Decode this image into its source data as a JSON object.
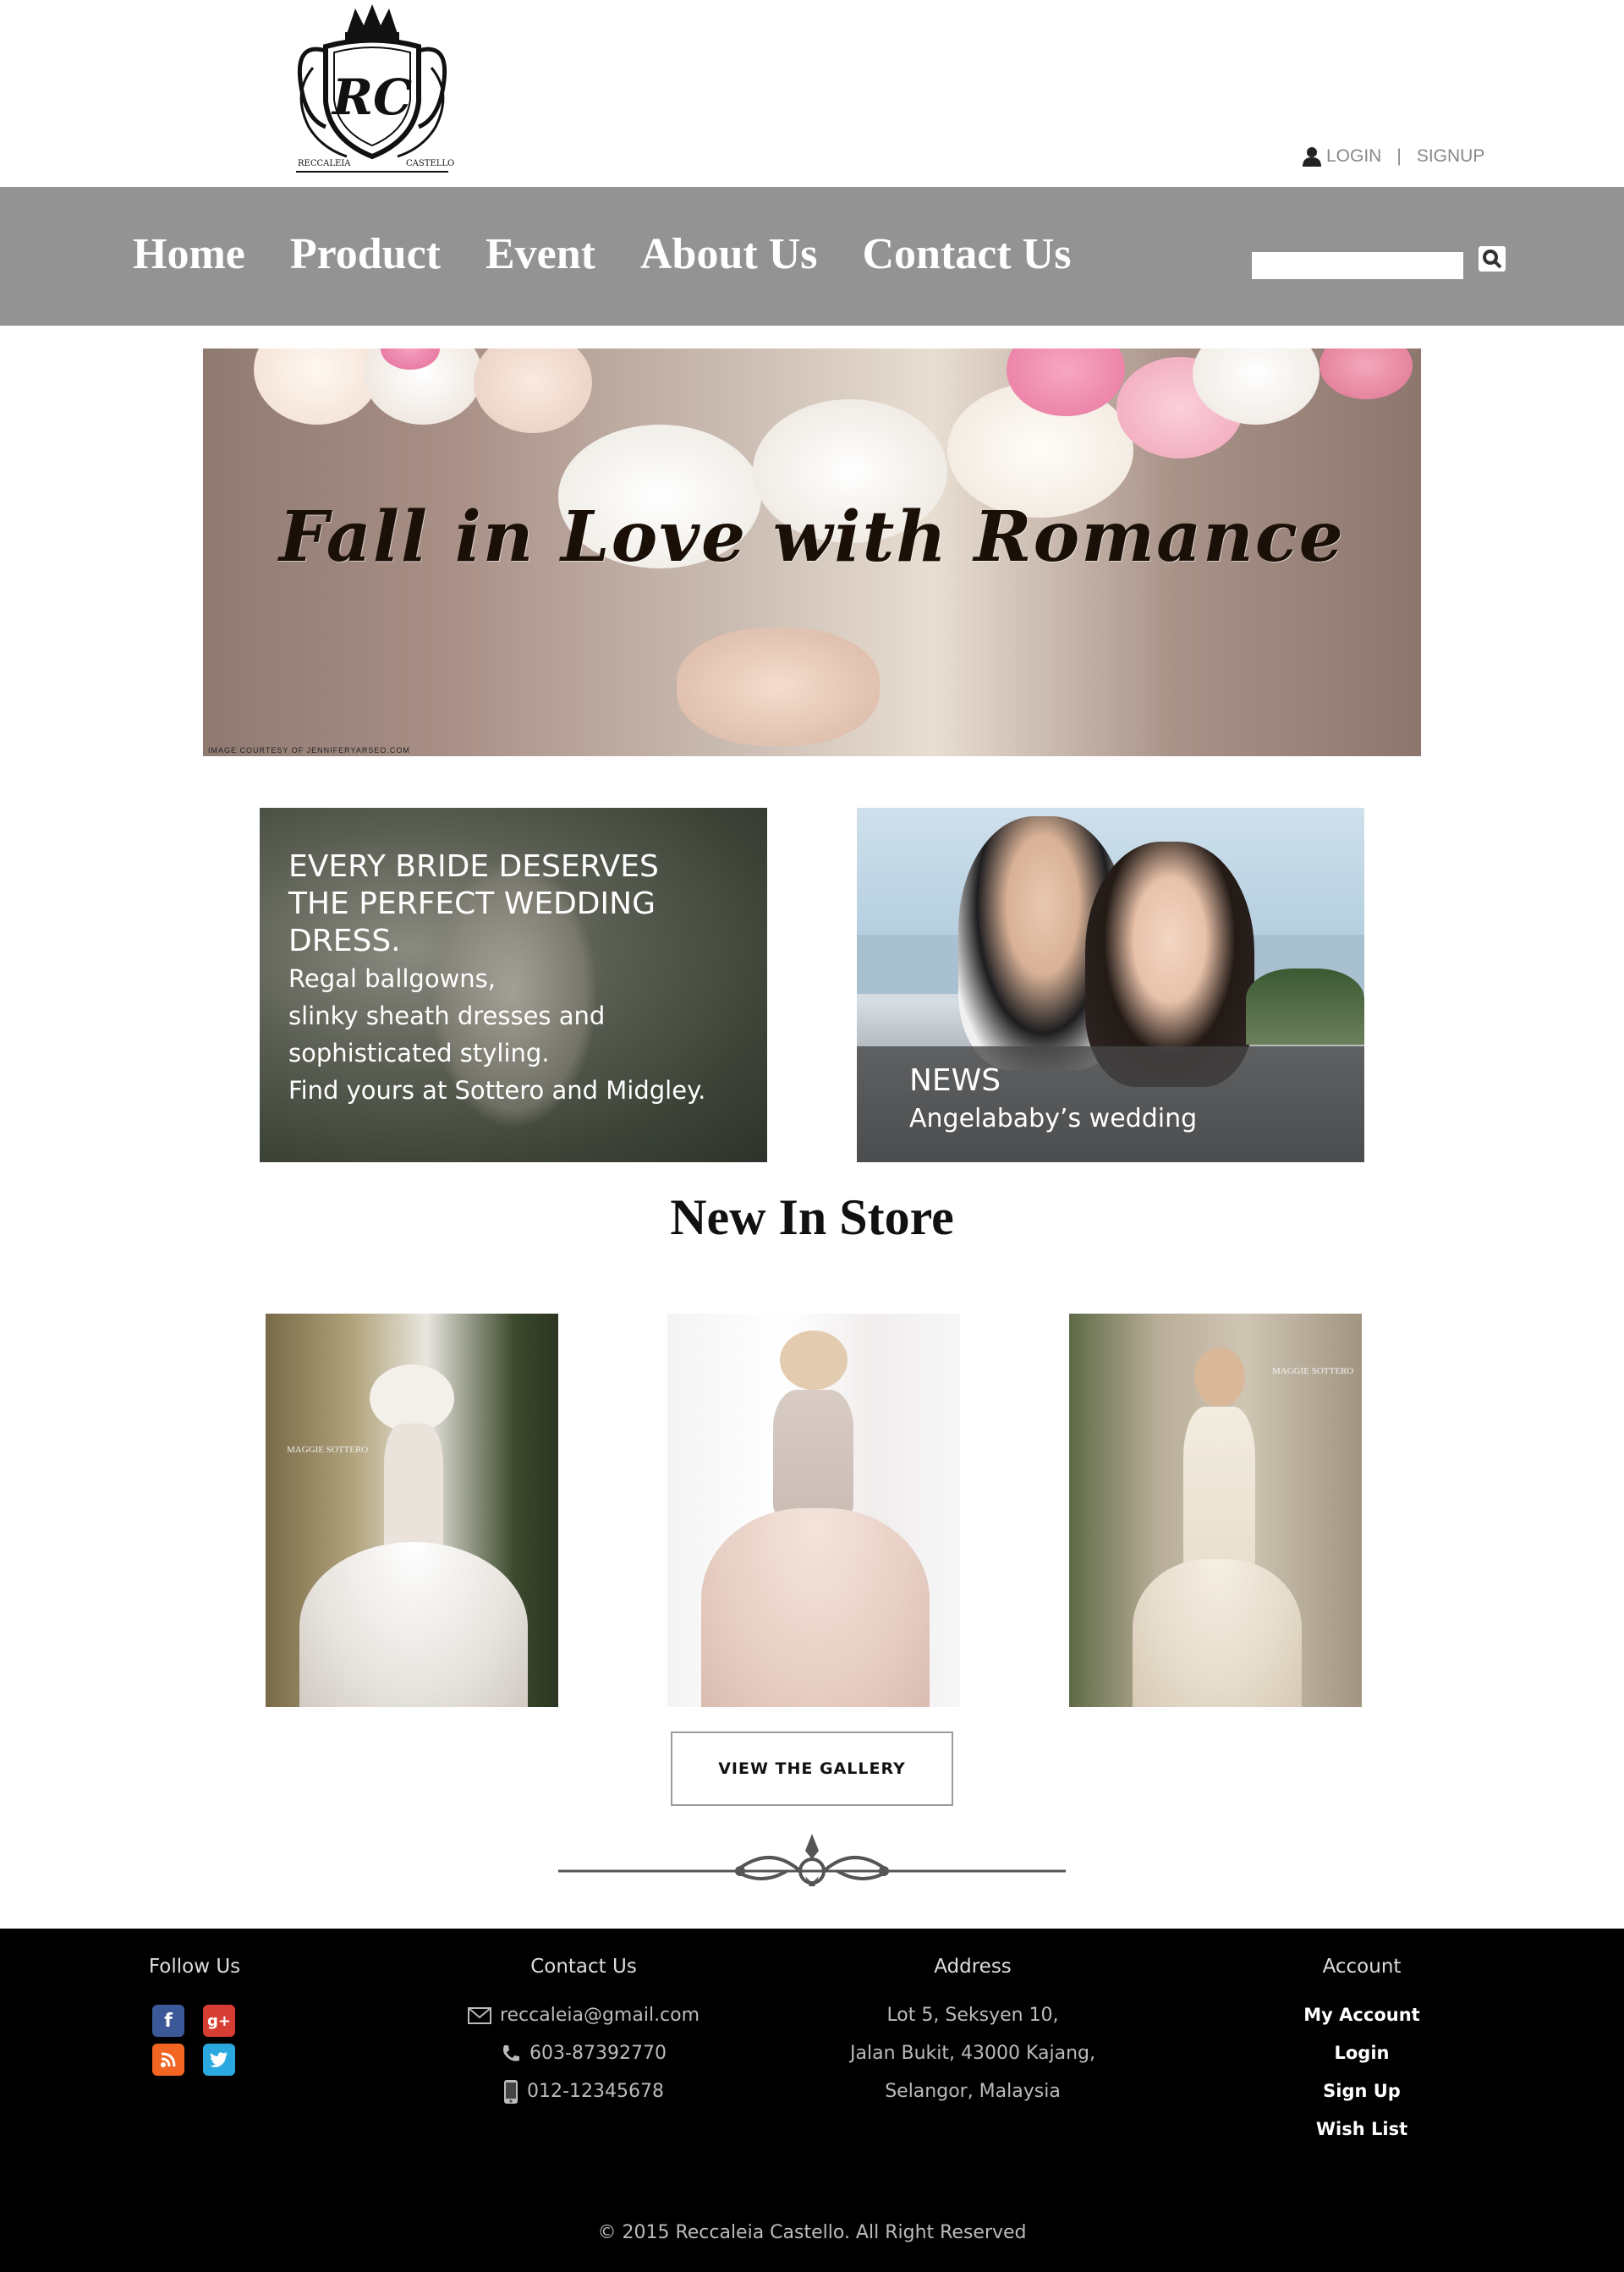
{
  "header": {
    "logo_text": "RC",
    "logo_caption_left": "RECCALEIA",
    "logo_caption_right": "CASTELLO",
    "login_label": "LOGIN",
    "separator": "|",
    "signup_label": "SIGNUP"
  },
  "nav": {
    "items": [
      {
        "label": "Home"
      },
      {
        "label": "Product"
      },
      {
        "label": "Event"
      },
      {
        "label": "About Us"
      },
      {
        "label": "Contact Us"
      }
    ],
    "search": {
      "placeholder": "",
      "value": ""
    }
  },
  "hero": {
    "headline": "Fall in Love with Romance",
    "credit": "IMAGE COURTESY OF  JENNIFERYARSEO.COM"
  },
  "promo_left": {
    "heading_line1": "EVERY BRIDE DESERVES",
    "heading_line2": "THE PERFECT WEDDING DRESS.",
    "body_line1": "Regal ballgowns,",
    "body_line2": "slinky sheath dresses and",
    "body_line3": "sophisticated styling.",
    "body_line4": "Find yours at Sottero and Midgley."
  },
  "promo_right": {
    "title": "NEWS",
    "subtitle": "Angelababy’s wedding"
  },
  "new_in_store": {
    "title": "New In Store",
    "products": [
      {
        "watermark": "MAGGIE SOTTERO"
      },
      {
        "watermark": ""
      },
      {
        "watermark": "MAGGIE SOTTERO"
      }
    ],
    "gallery_button": "VIEW THE GALLERY"
  },
  "footer": {
    "follow": {
      "heading": "Follow Us"
    },
    "contact": {
      "heading": "Contact Us",
      "email": "reccaleia@gmail.com",
      "phone": "603-87392770",
      "mobile": "012-12345678"
    },
    "address": {
      "heading": "Address",
      "line1": "Lot 5, Seksyen 10,",
      "line2": "Jalan Bukit, 43000 Kajang,",
      "line3": "Selangor, Malaysia"
    },
    "account": {
      "heading": "Account",
      "links": [
        {
          "label": "My Account"
        },
        {
          "label": "Login"
        },
        {
          "label": "Sign Up"
        },
        {
          "label": "Wish List"
        }
      ]
    },
    "copyright": "© 2015 Reccaleia Castello. All Right Reserved"
  },
  "colors": {
    "nav_bg": "#939393",
    "footer_bg": "#000000",
    "facebook": "#3b5998",
    "googleplus": "#d73d32",
    "rss": "#f26522",
    "twitter": "#2aa9e0"
  },
  "icons": [
    "user-icon",
    "search-icon",
    "facebook-icon",
    "google-plus-icon",
    "rss-icon",
    "twitter-icon",
    "mail-icon",
    "phone-icon",
    "mobile-icon"
  ]
}
